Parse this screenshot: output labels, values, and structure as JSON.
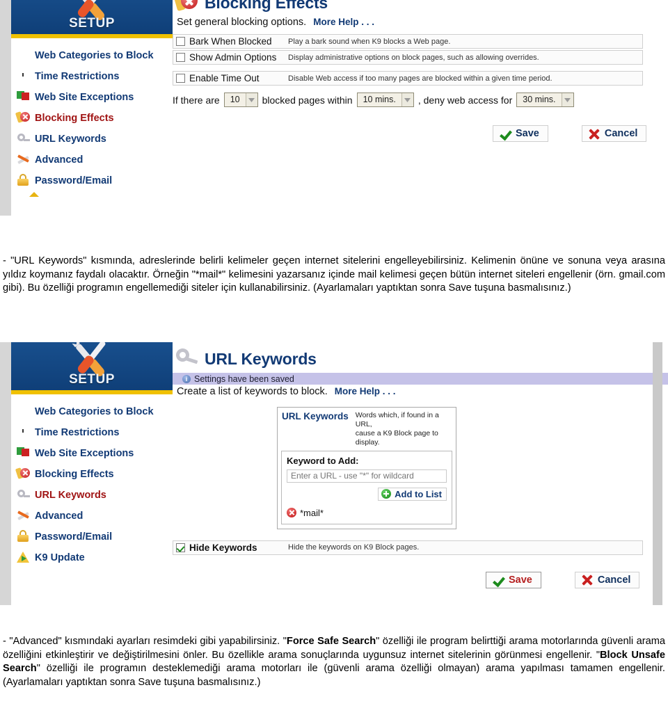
{
  "sidebar": {
    "setup_label": "SETUP",
    "items": [
      {
        "label": "Web Categories to Block",
        "icon": "globe-icon"
      },
      {
        "label": "Time Restrictions",
        "icon": "clock-icon"
      },
      {
        "label": "Web Site Exceptions",
        "icon": "flags-icon"
      },
      {
        "label": "Blocking Effects",
        "icon": "stop-sign-icon"
      },
      {
        "label": "URL Keywords",
        "icon": "key-icon"
      },
      {
        "label": "Advanced",
        "icon": "wrench-icon"
      },
      {
        "label": "Password/Email",
        "icon": "lock-icon"
      },
      {
        "label": "K9 Update",
        "icon": "update-warning-icon"
      }
    ]
  },
  "shot1": {
    "title": "Blocking Effects",
    "title_icon": "stop-sign-icon",
    "subline": "Set general blocking options.",
    "more_help": "More Help . . .",
    "options": [
      {
        "name": "Bark When Blocked",
        "desc": "Play a bark sound when K9 blocks a Web page.",
        "checked": false
      },
      {
        "name": "Show Admin Options",
        "desc": "Display administrative options on block pages, such as allowing overrides.",
        "checked": false
      },
      {
        "name": "Enable Time Out",
        "desc": "Disable Web access if too many pages are blocked within a given time period.",
        "checked": false
      }
    ],
    "timeout": {
      "text_1": "If there are",
      "count": "10",
      "text_2": "blocked pages within",
      "window": "10 mins.",
      "text_3": ", deny web access for",
      "duration": "30 mins."
    },
    "save_label": "Save",
    "cancel_label": "Cancel",
    "active_nav": 3
  },
  "shot2": {
    "title": "URL Keywords",
    "title_icon": "key-icon",
    "saved_notice": "Settings have been saved",
    "subline": "Create a list of keywords to block.",
    "more_help": "More Help . . .",
    "panel": {
      "heading": "URL Keywords",
      "desc_line1": "Words which, if found in a URL,",
      "desc_line2": "cause a K9 Block page to display.",
      "field_label": "Keyword to Add:",
      "input_value": "",
      "input_placeholder": "Enter a URL - use \"*\" for wildcard",
      "add_button": "Add to List",
      "keywords": [
        "*mail*"
      ]
    },
    "hide_row": {
      "name": "Hide Keywords",
      "desc": "Hide the keywords on K9 Block pages.",
      "checked": true
    },
    "save_label": "Save",
    "cancel_label": "Cancel",
    "active_nav": 4
  },
  "paragraphs": {
    "p1_part1": "- \"URL Keywords\" kısmında, adreslerinde belirli kelimeler geçen internet sitelerini engelleyebilirsiniz. Kelimenin önüne ve sonuna veya arasına yıldız koymanız faydalı olacaktır. Örneğin \"*mail*\" kelimesini yazarsanız içinde mail kelimesi geçen bütün internet siteleri engellenir (örn. gmail.com gibi). Bu özelliği programın engellemediği siteler için kullanabilirsiniz. (Ayarlamaları yaptıktan sonra Save tuşuna basmalısınız.)",
    "p2_a": "- \"Advanced\" kısmındaki ayarları resimdeki gibi yapabilirsiniz. \"",
    "p2_b": "Force Safe Search",
    "p2_c": "\" özelliği ile program belirttiği arama motorlarında güvenli arama özelliğini etkinleştirir ve değiştirilmesini önler. Bu özellikle arama sonuçlarında uygunsuz internet sitelerinin görünmesi engellenir. \"",
    "p2_d": "Block Unsafe Search",
    "p2_e": "\" özelliği ile programın desteklemediği arama motorları ile (güvenli arama özelliği olmayan) arama yapılması tamamen engellenir. (Ayarlamaları yaptıktan sonra Save tuşuna basmalısınız.)"
  }
}
